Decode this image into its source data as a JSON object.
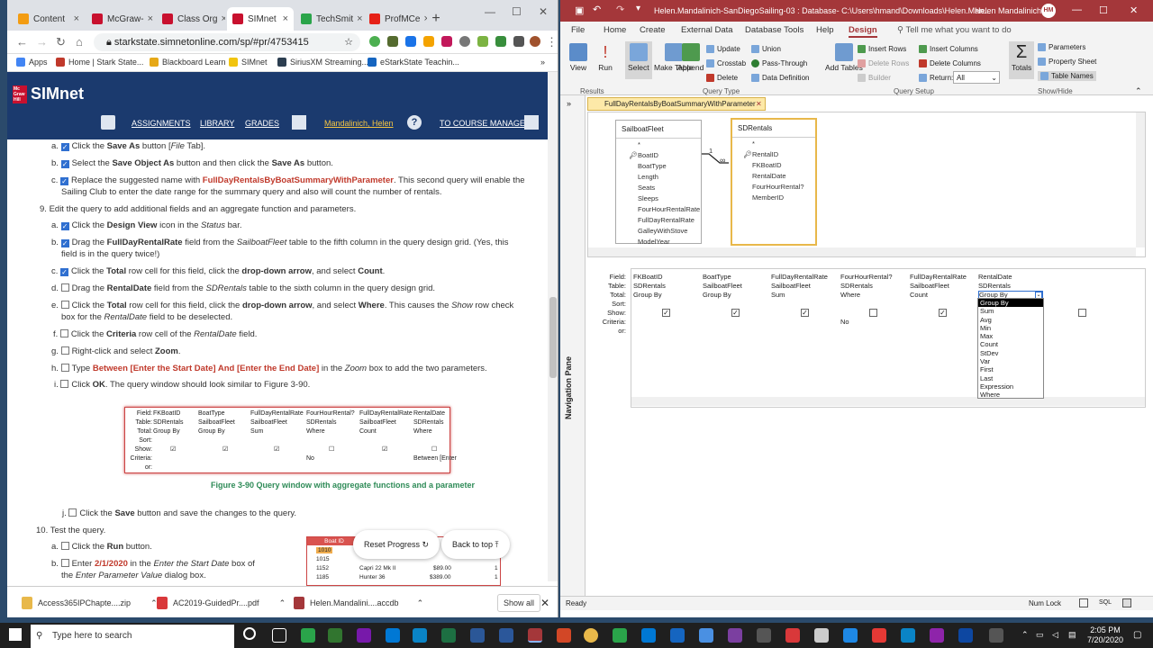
{
  "browser": {
    "tabs": [
      {
        "label": "Content",
        "color": "#f39c12"
      },
      {
        "label": "McGraw-",
        "color": "#c8102e"
      },
      {
        "label": "Class Org",
        "color": "#c8102e"
      },
      {
        "label": "SIMnet",
        "color": "#c8102e",
        "active": true
      },
      {
        "label": "TechSmit",
        "color": "#2aa44a"
      },
      {
        "label": "ProfMCe",
        "color": "#e62117"
      }
    ],
    "url": "starkstate.simnetonline.com/sp/#pr/4753415",
    "bookmarks": [
      "Apps",
      "Home | Stark State...",
      "Blackboard Learn",
      "SIMnet",
      "SiriusXM Streaming...",
      "eStarkState Teachin..."
    ]
  },
  "simnet": {
    "logo": "SIMnet",
    "logo_badge": "Mc Graw Hill",
    "nav": [
      "ASSIGNMENTS",
      "LIBRARY",
      "GRADES",
      "Mandalinich, Helen",
      "TO COURSE MANAGER"
    ]
  },
  "steps": {
    "s8a": {
      "n": "a.",
      "t1": "Click the ",
      "b1": "Save As",
      "t2": " button [",
      "i1": "File",
      "t3": " Tab]."
    },
    "s8b": {
      "n": "b.",
      "t1": "Select the ",
      "b1": "Save Object As",
      "t2": " button and then click the ",
      "b2": "Save As",
      "t3": " button."
    },
    "s8c": {
      "n": "c.",
      "t1": "Replace the suggested name with ",
      "r1": "FullDayRentalsByBoatSummaryWithParameter",
      "t2": ". This second query will enable the",
      "l2": "Sailing Club to enter the date range for the summary query and also will count the number of rentals."
    },
    "s9": {
      "n": "9.",
      "t1": "Edit the query to add additional fields and an aggregate function and parameters."
    },
    "s9a": {
      "n": "a.",
      "t1": "Click the ",
      "b1": "Design View",
      "t2": " icon in the ",
      "i1": "Status",
      "t3": " bar."
    },
    "s9b": {
      "n": "b.",
      "t1": "Drag the ",
      "b1": "FullDayRentalRate",
      "t2": " field from the ",
      "i1": "SailboatFleet",
      "t3": " table to the fifth column in the query design grid. (Yes, this",
      "l2": "field is in the query twice!)"
    },
    "s9c": {
      "n": "c.",
      "t1": "Click the ",
      "b1": "Total",
      "t2": " row cell for this field, click the ",
      "b2": "drop-down arrow",
      "t3": ", and select ",
      "b3": "Count",
      "t4": "."
    },
    "s9d": {
      "n": "d.",
      "t1": "Drag the ",
      "b1": "RentalDate",
      "t2": " field from the ",
      "i1": "SDRentals",
      "t3": " table to the sixth column in the query design grid."
    },
    "s9e": {
      "n": "e.",
      "t1": "Click the ",
      "b1": "Total",
      "t2": " row cell for this field, click the ",
      "b2": "drop-down arrow",
      "t3": ", and select ",
      "b3": "Where",
      "t4": ". This causes the ",
      "i1": "Show",
      "t5": " row check",
      "l2a": "box for the ",
      "l2i": "RentalDate",
      "l2b": " field to be deselected."
    },
    "s9f": {
      "n": "f.",
      "t1": "Click the ",
      "b1": "Criteria",
      "t2": " row cell of the ",
      "i1": "RentalDate",
      "t3": " field."
    },
    "s9g": {
      "n": "g.",
      "t1": "Right-click and select ",
      "b1": "Zoom",
      "t2": "."
    },
    "s9h": {
      "n": "h.",
      "t1": "Type ",
      "r1": "Between [Enter the Start Date] And [Enter the End Date]",
      "t2": " in the ",
      "i1": "Zoom",
      "t3": " box to add the two parameters."
    },
    "s9i": {
      "n": "i.",
      "t1": "Click ",
      "b1": "OK",
      "t2": ". The query window should look similar to Figure 3-90."
    },
    "s9j": {
      "n": "j.",
      "t1": "Click the ",
      "b1": "Save",
      "t2": " button and save the changes to the query."
    },
    "s10": {
      "n": "10.",
      "t1": "Test the query."
    },
    "s10a": {
      "n": "a.",
      "t1": "Click the ",
      "b1": "Run",
      "t2": " button."
    },
    "s10b": {
      "n": "b.",
      "t1": "Enter ",
      "r1": "2/1/2020",
      "t2": " in the ",
      "i1": "Enter the Start Date",
      "t3": " box of",
      "l2a": "the ",
      "l2i": "Enter Parameter Value",
      "l2b": " dialog box."
    }
  },
  "figure": {
    "row_labels": [
      "Field:",
      "Table:",
      "Total:",
      "Sort:",
      "Show:",
      "Criteria:",
      "or:"
    ],
    "columns": [
      {
        "field": "FKBoatID",
        "table": "SDRentals",
        "total": "Group By",
        "show": true,
        "criteria": ""
      },
      {
        "field": "BoatType",
        "table": "SailboatFleet",
        "total": "Group By",
        "show": true,
        "criteria": ""
      },
      {
        "field": "FullDayRentalRate",
        "table": "SailboatFleet",
        "total": "Sum",
        "show": true,
        "criteria": ""
      },
      {
        "field": "FourHourRental?",
        "table": "SDRentals",
        "total": "Where",
        "show": false,
        "criteria": "No"
      },
      {
        "field": "FullDayRentalRate",
        "table": "SailboatFleet",
        "total": "Count",
        "show": true,
        "criteria": ""
      },
      {
        "field": "RentalDate",
        "table": "SDRentals",
        "total": "Where",
        "show": false,
        "criteria": "Between [Enter"
      }
    ],
    "caption": "Figure 3-90 Query window with aggregate functions and a parameter"
  },
  "mini_table": {
    "header": "Boat ID",
    "rows": [
      [
        "1010",
        "",
        ""
      ],
      [
        "1015",
        "",
        ""
      ],
      [
        "1152",
        "Capri 22 Mk II",
        "$89.00"
      ],
      [
        "1185",
        "Hunter 36",
        "$389.00"
      ]
    ],
    "counts": [
      "1",
      "1"
    ]
  },
  "float_buttons": {
    "reset": "Reset Progress",
    "back": "Back to top"
  },
  "downloads": [
    {
      "name": "Access365IPChapte....zip",
      "color": "#e8b84a"
    },
    {
      "name": "AC2019-GuidedPr....pdf",
      "color": "#d9383a"
    },
    {
      "name": "Helen.Mandalini....accdb",
      "color": "#a4373a"
    }
  ],
  "show_all": "Show all",
  "access": {
    "title": "Helen.Mandalinich-SanDiegoSailing-03 : Database- C:\\Users\\hmand\\Downloads\\Helen.Man...",
    "user": "Helen Mandalinich",
    "user_initials": "HM",
    "ribbon_tabs": [
      "File",
      "Home",
      "Create",
      "External Data",
      "Database Tools",
      "Help",
      "Design"
    ],
    "tell_me": "Tell me what you want to do",
    "results": {
      "view": "View",
      "run": "Run",
      "label": "Results"
    },
    "query_type": {
      "select": "Select",
      "make_table": "Make Table",
      "append": "Append",
      "update": "Update",
      "crosstab": "Crosstab",
      "delete": "Delete",
      "union": "Union",
      "pass_through": "Pass-Through",
      "data_definition": "Data Definition",
      "label": "Query Type"
    },
    "query_setup": {
      "add_tables": "Add Tables",
      "insert_rows": "Insert Rows",
      "delete_rows": "Delete Rows",
      "builder": "Builder",
      "insert_columns": "Insert Columns",
      "delete_columns": "Delete Columns",
      "return_label": "Return:",
      "return_value": "All",
      "label": "Query Setup"
    },
    "show_hide": {
      "totals": "Totals",
      "parameters": "Parameters",
      "property_sheet": "Property Sheet",
      "table_names": "Table Names",
      "label": "Show/Hide"
    },
    "nav_pane": "Navigation Pane",
    "query_tab": "FullDayRentalsByBoatSummaryWithParameter",
    "table1": {
      "name": "SailboatFleet",
      "fields": [
        "*",
        "BoatID",
        "BoatType",
        "Length",
        "Seats",
        "Sleeps",
        "FourHourRentalRate",
        "FullDayRentalRate",
        "GalleyWithStove",
        "ModelYear"
      ]
    },
    "table2": {
      "name": "SDRentals",
      "fields": [
        "*",
        "RentalID",
        "FKBoatID",
        "RentalDate",
        "FourHourRental?",
        "MemberID"
      ]
    },
    "rel_one": "1",
    "rel_many": "∞",
    "grid_labels": [
      "Field:",
      "Table:",
      "Total:",
      "Sort:",
      "Show:",
      "Criteria:",
      "or:"
    ],
    "grid": [
      {
        "field": "FKBoatID",
        "table": "SDRentals",
        "total": "Group By",
        "show": true,
        "criteria": ""
      },
      {
        "field": "BoatType",
        "table": "SailboatFleet",
        "total": "Group By",
        "show": true,
        "criteria": ""
      },
      {
        "field": "FullDayRentalRate",
        "table": "SailboatFleet",
        "total": "Sum",
        "show": true,
        "criteria": ""
      },
      {
        "field": "FourHourRental?",
        "table": "SDRentals",
        "total": "Where",
        "show": false,
        "criteria": "No"
      },
      {
        "field": "FullDayRentalRate",
        "table": "SailboatFleet",
        "total": "Count",
        "show": true,
        "criteria": ""
      },
      {
        "field": "RentalDate",
        "table": "SDRentals",
        "total": "Group By",
        "show": null,
        "criteria": ""
      }
    ],
    "dropdown": [
      "Group By",
      "Sum",
      "Avg",
      "Min",
      "Max",
      "Count",
      "StDev",
      "Var",
      "First",
      "Last",
      "Expression",
      "Where"
    ],
    "dropdown_selected": "Group By",
    "status": "Ready",
    "numlock": "Num Lock"
  },
  "taskbar": {
    "search": "Type here to search",
    "time": "2:05 PM",
    "date": "7/20/2020"
  }
}
